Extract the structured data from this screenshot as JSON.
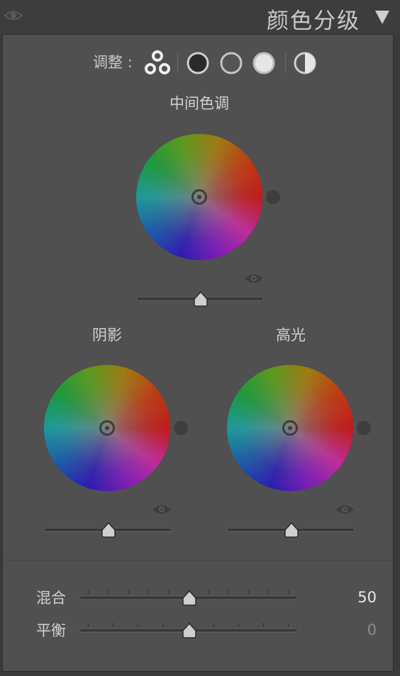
{
  "header": {
    "title": "颜色分级",
    "visibility_icon": "eye-icon",
    "collapse_icon": "triangle-down-icon"
  },
  "adjust": {
    "label": "调整 :",
    "modes": [
      {
        "name": "three-way-icon",
        "selected": true
      },
      {
        "name": "shadows-icon"
      },
      {
        "name": "midtones-icon"
      },
      {
        "name": "highlights-icon"
      },
      {
        "name": "global-icon"
      }
    ]
  },
  "wheels": {
    "midtones": {
      "title": "中间色调",
      "luminance": 0
    },
    "shadows": {
      "title": "阴影",
      "luminance": 0
    },
    "highlights": {
      "title": "高光",
      "luminance": 0
    }
  },
  "blending": {
    "label": "混合",
    "value": "50"
  },
  "balance": {
    "label": "平衡",
    "value": "0"
  },
  "colors": {
    "panel": "#505050",
    "value_active": "#e8e8e8",
    "value_dim": "#8a8a8a"
  }
}
